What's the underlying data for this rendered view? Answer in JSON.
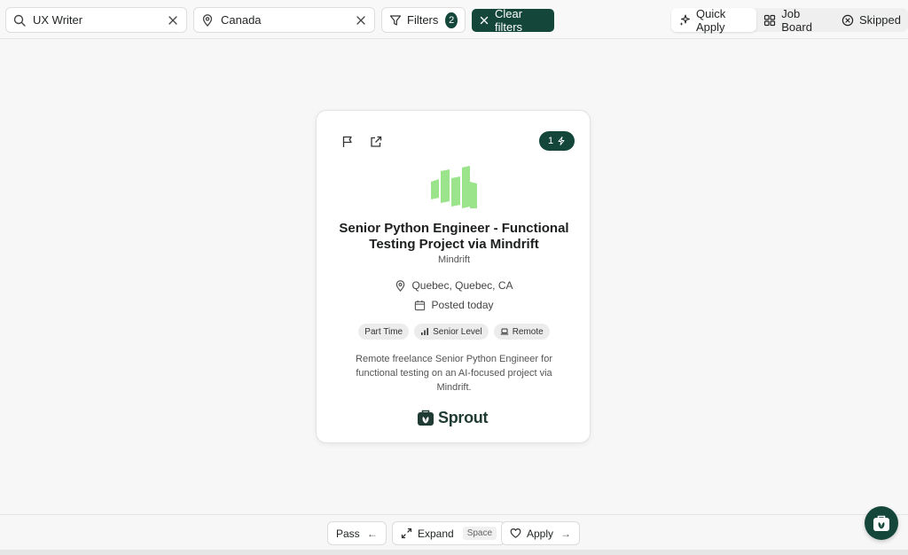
{
  "search": {
    "keyword": "UX Writer",
    "location": "Canada"
  },
  "filters": {
    "label": "Filters",
    "count": "2",
    "clear_label": "Clear filters"
  },
  "modes": [
    {
      "label": "Quick Apply",
      "active": true
    },
    {
      "label": "Job Board",
      "active": false
    },
    {
      "label": "Skipped",
      "active": false
    }
  ],
  "job": {
    "title": "Senior Python Engineer - Functional Testing Project via Mindrift",
    "company": "Mindrift",
    "location": "Quebec, Quebec, CA",
    "posted": "Posted today",
    "tags": [
      "Part Time",
      "Senior Level",
      "Remote"
    ],
    "description": "Remote freelance Senior Python Engineer for functional testing on an AI-focused project via Mindrift.",
    "boost_count": "1",
    "source": "Sprout"
  },
  "actions": {
    "pass_label": "Pass",
    "expand_label": "Expand",
    "expand_key": "Space",
    "apply_label": "Apply"
  },
  "colors": {
    "brand": "#14473a",
    "logo_green": "#9be48b"
  }
}
